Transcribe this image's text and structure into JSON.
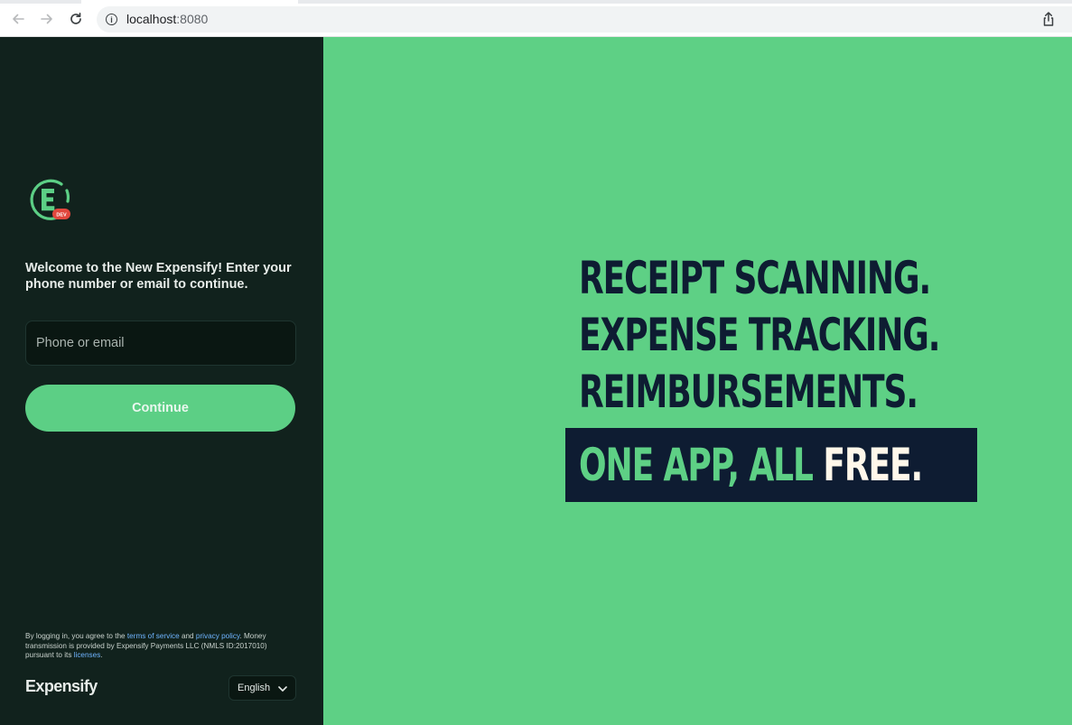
{
  "browser": {
    "url_host": "localhost",
    "url_port": ":8080",
    "back_icon": "arrow-left-icon",
    "forward_icon": "arrow-right-icon",
    "reload_icon": "reload-icon",
    "share_icon": "share-icon"
  },
  "login": {
    "logo_badge": "DEV",
    "welcome": "Welcome to the New Expensify! Enter your phone number or email to continue.",
    "input_placeholder": "Phone or email",
    "continue_label": "Continue",
    "legal_prefix": "By logging in, you agree to the ",
    "legal_terms": "terms of service",
    "legal_and": " and ",
    "legal_privacy": "privacy policy",
    "legal_mid": ". Money transmission is provided by Expensify Payments LLC (NMLS ID:2017010) pursuant to its ",
    "legal_licenses": "licenses",
    "legal_end": ".",
    "wordmark": "Expensify",
    "language": "English"
  },
  "hero": {
    "line1": "RECEIPT SCANNING.",
    "line2": "EXPENSE TRACKING.",
    "line3": "REIMBURSEMENTS.",
    "line4_green": "ONE APP, ALL ",
    "line4_white": "FREE."
  },
  "colors": {
    "left_bg": "#11221d",
    "right_bg": "#5ed085",
    "accent_green": "#5ccf85",
    "navy": "#0e1c32",
    "badge_red": "#e2473d"
  }
}
